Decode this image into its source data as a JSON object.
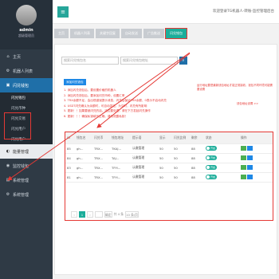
{
  "sidebar": {
    "username": "admin",
    "role": "超级管理员",
    "menu": [
      {
        "label": "主页",
        "icon": "home-icon"
      },
      {
        "label": "机器人列表",
        "icon": "robot-icon"
      },
      {
        "label": "闪兑钱包",
        "icon": "wallet-icon"
      }
    ],
    "submenu": [
      "闪兑钱包",
      "闪兑币种",
      "闪兑交易",
      "闪兑用户",
      "闪兑用户"
    ],
    "menu2": [
      {
        "label": "能量管理",
        "icon": "energy-icon"
      },
      {
        "label": "监控钱包",
        "icon": "monitor-icon"
      },
      {
        "label": "系统管理",
        "icon": "system-icon"
      },
      {
        "label": "系统管理",
        "icon": "settings-icon"
      }
    ]
  },
  "topbar": {
    "welcome": "欢迎登录TG机器人-转账-监控管理后台"
  },
  "tabs": [
    "主页",
    "机器人列表",
    "关键字回复",
    "自动发送",
    "广告推送",
    "闪兑钱包"
  ],
  "panel": {
    "search_placeholder_1": "搜索闪兑钱包名",
    "search_placeholder_2": "搜索闪兑钱包地址",
    "add_button": "添加闪兑钱包",
    "notes": [
      "1. 添加闪兑钱包后，要设置价格的机器人",
      "2. 添加闪兑钱包后，要添加闪兑币种，设置汇率",
      "3. TRX余额不足，会出现错误提示消息，闪兑后保证TRX余额，0表示不启动闪兑",
      "4. USDT闪兑确认为余额时，可自动发送，为空时，闪兑有所影响",
      "5. 更新！！如果要被闪兑的话，这边要处理，请在下方发起闪兑操作",
      "6. 更新！！！确保私钥填写正确，请勿泄露私钥！"
    ],
    "right_note": "运行地址要是最新钱包地址才能正常接收，钱包不同环境可能需要设置",
    "right_link": "钱包地址设置 >>"
  },
  "table": {
    "headers": [
      "ID",
      "钱包名",
      "闪兑币",
      "钱包地址",
      "提示语",
      "显示",
      "闪兑比例",
      "剩余",
      "状态",
      "操作"
    ],
    "rows": [
      [
        "85",
        "gh...",
        "TRX...",
        "TKAJ...",
        "认缴管理",
        "50",
        "50",
        "88",
        "开启",
        ""
      ],
      [
        "84",
        "gh...",
        "TRX...",
        "TAJ...",
        "认缴管理",
        "50",
        "50",
        "88",
        "开启",
        ""
      ],
      [
        "83",
        "gh...",
        "TRX...",
        "TFYi...",
        "认缴管理",
        "50",
        "50",
        "88",
        "开启",
        ""
      ],
      [
        "81",
        "gh...",
        "TRX...",
        "TFYi...",
        "认缴管理",
        "50",
        "50",
        "88",
        "开启",
        ""
      ]
    ],
    "pager": {
      "page": "1",
      "goto": "确定",
      "total": "共 4 条",
      "per": "10 条/页"
    }
  }
}
